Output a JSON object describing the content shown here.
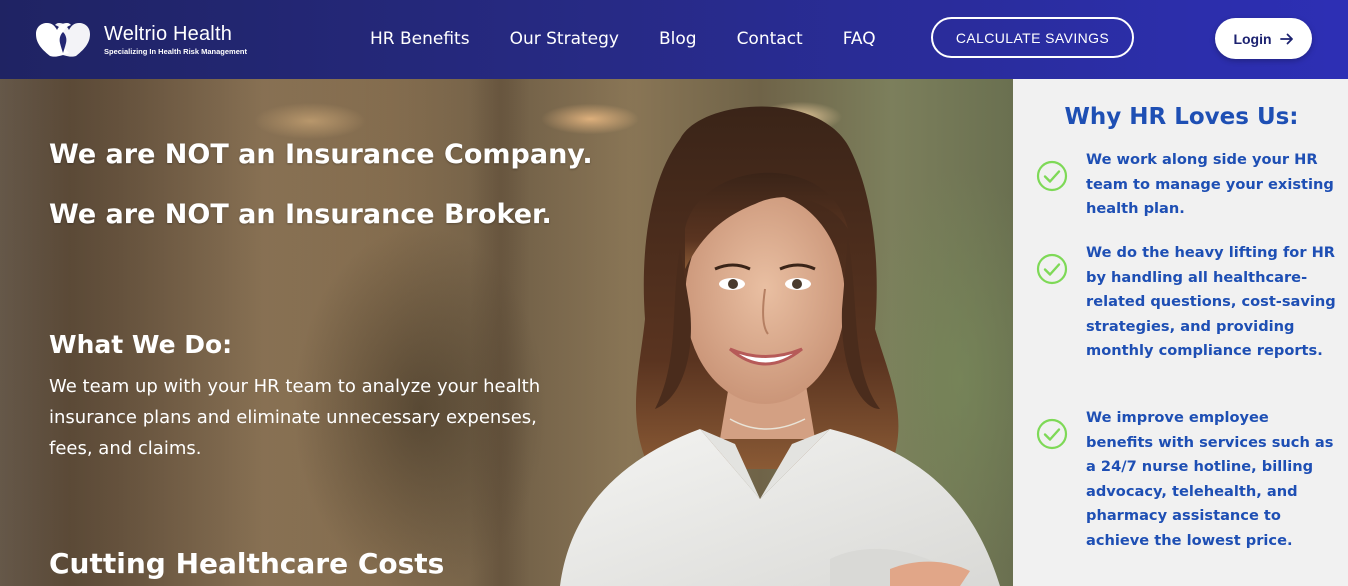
{
  "brand": {
    "name": "Weltrio Health",
    "tagline": "Specializing In Health Risk Management"
  },
  "nav": {
    "items": [
      "HR Benefits",
      "Our Strategy",
      "Blog",
      "Contact",
      "FAQ"
    ],
    "cta_label": "CALCULATE SAVINGS",
    "login_label": "Login"
  },
  "hero": {
    "headline_1": "We are NOT an Insurance Company.",
    "headline_2": "We are NOT an Insurance Broker.",
    "what_title": "What We Do:",
    "what_text": "We team up with your HR team to analyze your health insurance plans and eliminate unnecessary expenses, fees, and claims.",
    "section_heading": "Cutting Healthcare Costs"
  },
  "panel": {
    "title": "Why HR Loves Us:",
    "items": [
      "We work along side your HR team to manage your existing health plan.",
      "We do the heavy lifting for HR by handling all healthcare-related questions, cost-saving strategies, and providing monthly compliance reports.",
      "We improve employee benefits with services such as a 24/7 nurse hotline, billing advocacy, telehealth, and pharmacy assistance to achieve the lowest price."
    ]
  },
  "icons": {
    "logo": "double-heart-logo-icon",
    "login_arrow": "arrow-right-icon",
    "check": "check-circle-icon"
  },
  "colors": {
    "header_start": "#1f2363",
    "header_end": "#2d2fb5",
    "panel_text": "#1e4fb4",
    "check": "#7ed957",
    "panel_bg": "#f1f1f1"
  }
}
